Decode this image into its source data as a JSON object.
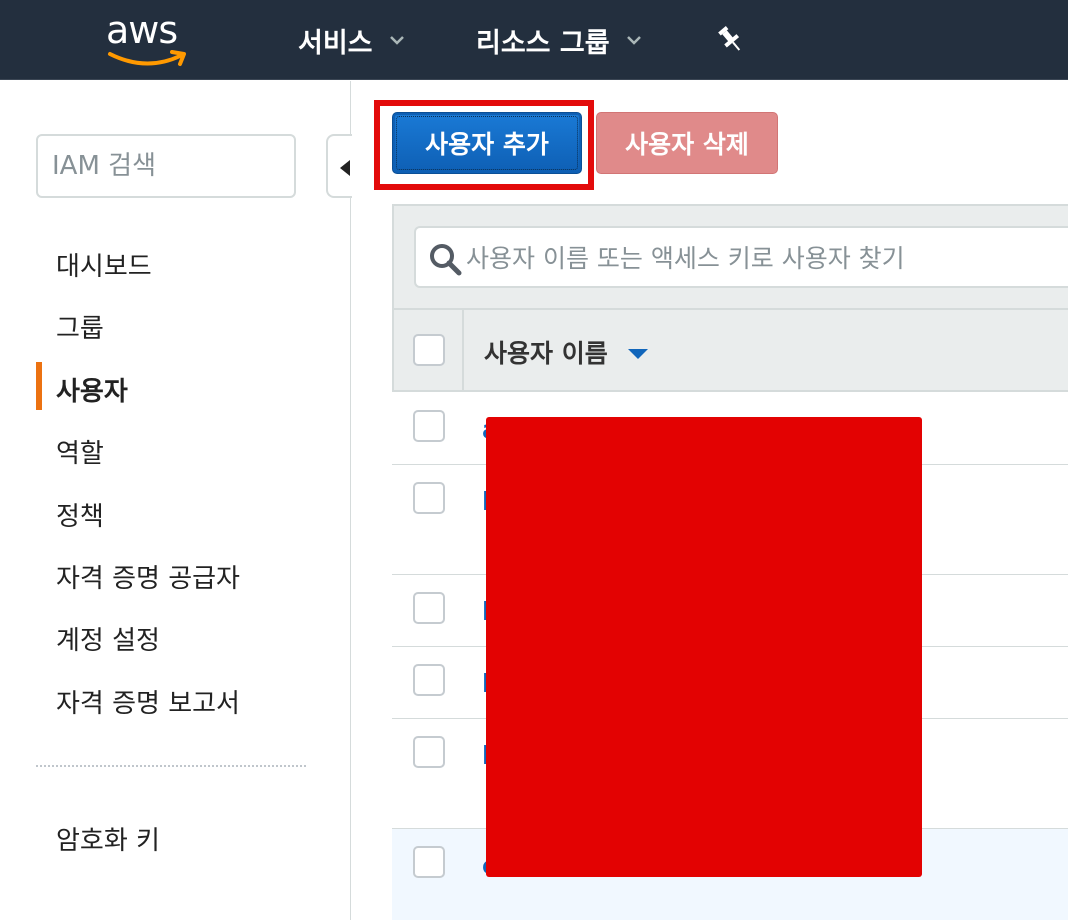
{
  "topnav": {
    "logo_text": "aws",
    "services_label": "서비스",
    "resource_groups_label": "리소스 그룹",
    "brand_color": "#232f3e",
    "accent_color": "#ff9900"
  },
  "sidebar": {
    "search_placeholder": "IAM 검색",
    "items": [
      {
        "label": "대시보드",
        "active": false
      },
      {
        "label": "그룹",
        "active": false
      },
      {
        "label": "사용자",
        "active": true
      },
      {
        "label": "역할",
        "active": false
      },
      {
        "label": "정책",
        "active": false
      },
      {
        "label": "자격 증명 공급자",
        "active": false
      },
      {
        "label": "계정 설정",
        "active": false
      },
      {
        "label": "자격 증명 보고서",
        "active": false
      }
    ],
    "secondary_items": [
      {
        "label": "암호화 키"
      }
    ],
    "active_color": "#ec7211"
  },
  "toolbar": {
    "add_user_label": "사용자 추가",
    "delete_user_label": "사용자 삭제"
  },
  "table": {
    "search_placeholder": "사용자 이름 또는 액세스 키로 사용자 찾기",
    "column_username": "사용자 이름",
    "rows": [
      {
        "name_visible": "a",
        "selected": false
      },
      {
        "name_visible": "k",
        "selected": false
      },
      {
        "name_visible": "k",
        "selected": false
      },
      {
        "name_visible": "k",
        "selected": false
      },
      {
        "name_visible": "k",
        "selected": false
      },
      {
        "name_visible": "c",
        "selected": true
      }
    ],
    "link_color": "#1166bb"
  },
  "icons": {
    "pin": "pin-icon",
    "search": "search-icon",
    "chevron": "chevron-down-icon",
    "collapse": "collapse-sidebar-icon",
    "sort": "sort-desc-icon"
  }
}
